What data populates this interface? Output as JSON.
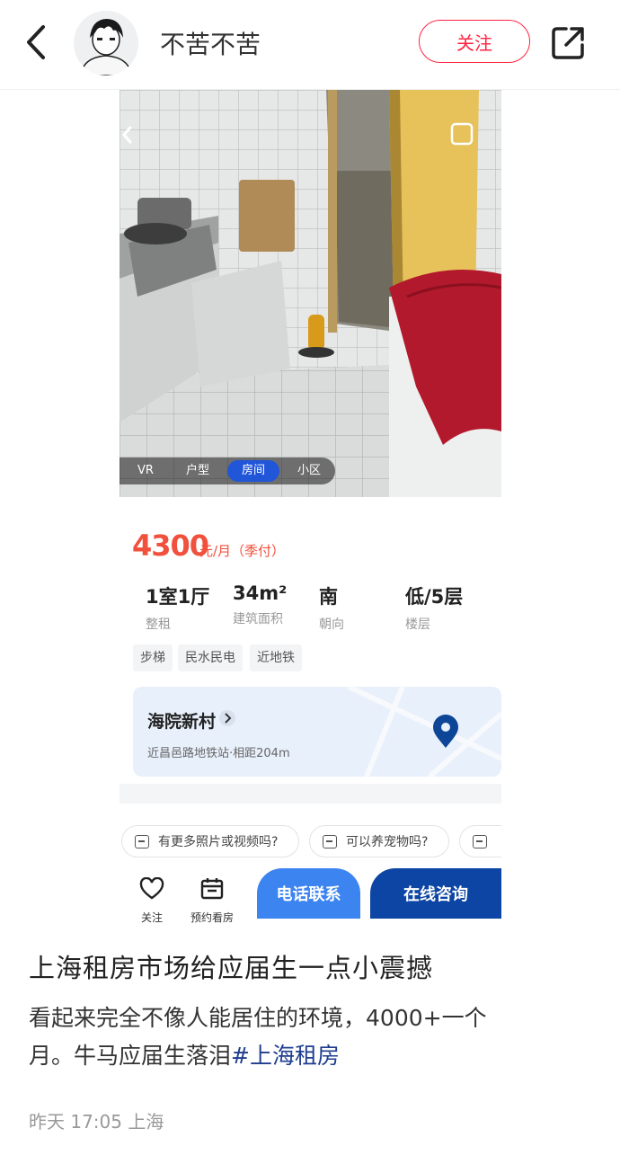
{
  "header": {
    "author": "不苦不苦",
    "follow_label": "关注"
  },
  "photo": {
    "mode_tabs": [
      {
        "label": "VR",
        "active": false
      },
      {
        "label": "户型",
        "active": false
      },
      {
        "label": "房间",
        "active": true
      },
      {
        "label": "小区",
        "active": false
      }
    ]
  },
  "listing": {
    "price": "4300",
    "price_unit": "元/月（季付）",
    "specs": [
      {
        "value": "1室1厅",
        "label": "整租"
      },
      {
        "value": "34m²",
        "label": "建筑面积"
      },
      {
        "value": "南",
        "label": "朝向"
      },
      {
        "value": "低/5层",
        "label": "楼层"
      }
    ],
    "tags": [
      "步梯",
      "民水民电",
      "近地铁"
    ],
    "community": "海院新村",
    "distance": "近昌邑路地铁站·相距204m",
    "questions": [
      "有更多照片或视频吗?",
      "可以养宠物吗?"
    ],
    "actions": {
      "follow": "关注",
      "schedule": "预约看房",
      "call": "电话联系",
      "chat": "在线咨询"
    }
  },
  "post": {
    "title": "上海租房市场给应届生一点小震撼",
    "body_line1": "看起来完全不像人能居住的环境，4000+一个",
    "body_line2": "月。牛马应届生落泪",
    "hashtag": "#上海租房",
    "meta": "昨天 17:05 上海"
  },
  "colors": {
    "accent_red": "#ff2442",
    "price_red": "#f0503c",
    "call_blue": "#3c84f0",
    "chat_blue": "#0c45a3",
    "hashtag_blue": "#1f3d8f"
  },
  "icons": [
    "back-chevron-icon",
    "share-icon",
    "location-pin-icon",
    "heart-icon",
    "calendar-icon",
    "chat-bubble-icon"
  ]
}
